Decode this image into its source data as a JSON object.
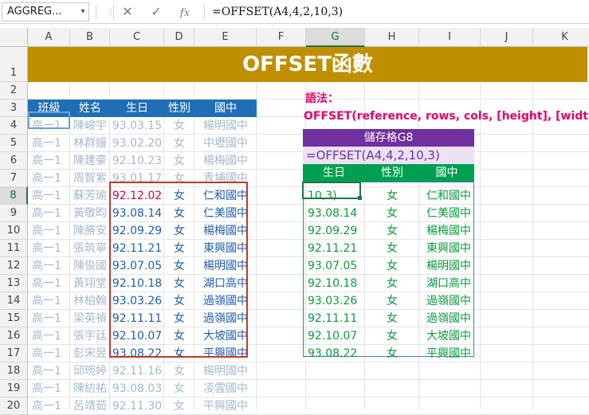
{
  "formula_bar": {
    "name_box": "AGGREG...",
    "cancel_icon": "✕",
    "enter_icon": "✓",
    "fx_label": "fx",
    "formula": "=OFFSET(A4,4,2,10,3)"
  },
  "columns": [
    "A",
    "B",
    "C",
    "D",
    "E",
    "F",
    "G",
    "H",
    "I",
    "J",
    "K"
  ],
  "rows": [
    "1",
    "2",
    "3",
    "4",
    "5",
    "6",
    "7",
    "8",
    "9",
    "10",
    "11",
    "12",
    "13",
    "14",
    "15",
    "16",
    "17",
    "18",
    "19",
    "20"
  ],
  "sheet": {
    "title": "OFFSET函數",
    "left_table": {
      "headers": [
        "班級",
        "姓名",
        "生日",
        "性別",
        "國中"
      ],
      "rows": [
        [
          "高一1",
          "陳峻宇",
          "93.03.15",
          "女",
          "楊明國中"
        ],
        [
          "高一1",
          "林群嫚",
          "93.02.20",
          "女",
          "中壢國中"
        ],
        [
          "高一1",
          "陳建豪",
          "92.10.23",
          "女",
          "楊梅國中"
        ],
        [
          "高一1",
          "周智紫",
          "93.01.17",
          "女",
          "青埔國中"
        ],
        [
          "高一1",
          "蘇芳瑜",
          "92.12.02",
          "女",
          "仁和國中"
        ],
        [
          "高一1",
          "黃敬昀",
          "93.08.14",
          "女",
          "仁美國中"
        ],
        [
          "高一1",
          "陳勝安",
          "92.09.29",
          "女",
          "楊梅國中"
        ],
        [
          "高一1",
          "張筑寧",
          "92.11.21",
          "女",
          "東興國中"
        ],
        [
          "高一1",
          "陳俊國",
          "93.07.05",
          "女",
          "楊明國中"
        ],
        [
          "高一1",
          "黃翊堂",
          "92.10.18",
          "女",
          "湖口高中"
        ],
        [
          "高一1",
          "林柏翰",
          "93.03.26",
          "女",
          "過嶺國中"
        ],
        [
          "高一1",
          "梁英禎",
          "92.11.11",
          "女",
          "過嶺國中"
        ],
        [
          "高一1",
          "張宇廷",
          "92.10.07",
          "女",
          "大坡國中"
        ],
        [
          "高一1",
          "彭宋昱",
          "93.08.22",
          "女",
          "平興國中"
        ],
        [
          "高一1",
          "邱琬婷",
          "92.11.16",
          "女",
          "楊明國中"
        ],
        [
          "高一1",
          "陳紡祐",
          "93.08.03",
          "女",
          "凌雲國中"
        ],
        [
          "高一1",
          "呂靖茹",
          "92.11.30",
          "女",
          "平興國中"
        ]
      ]
    },
    "syntax_label": "語法：",
    "syntax": "OFFSET(reference, rows, cols, [height], [width])",
    "cell_label": "儲存格G8",
    "cell_formula": "=OFFSET(A4,4,2,10,3)",
    "result_headers": [
      "生日",
      "性別",
      "國中"
    ],
    "result_rows": [
      [
        "10,3)",
        "女",
        "仁和國中"
      ],
      [
        "93.08.14",
        "女",
        "仁美國中"
      ],
      [
        "92.09.29",
        "女",
        "楊梅國中"
      ],
      [
        "92.11.21",
        "女",
        "東興國中"
      ],
      [
        "93.07.05",
        "女",
        "楊明國中"
      ],
      [
        "92.10.18",
        "女",
        "湖口高中"
      ],
      [
        "93.03.26",
        "女",
        "過嶺國中"
      ],
      [
        "92.11.11",
        "女",
        "過嶺國中"
      ],
      [
        "92.10.07",
        "女",
        "大坡國中"
      ],
      [
        "93.08.22",
        "女",
        "平興國中"
      ]
    ]
  }
}
